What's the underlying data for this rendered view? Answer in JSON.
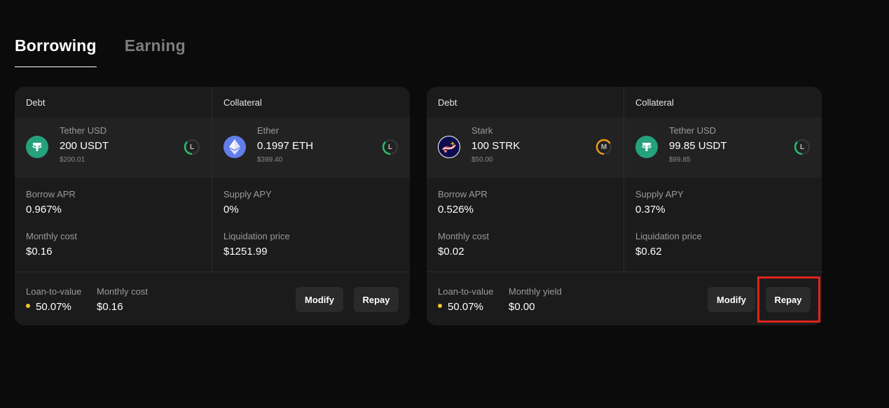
{
  "tabs": [
    {
      "label": "Borrowing",
      "active": true
    },
    {
      "label": "Earning",
      "active": false
    }
  ],
  "positions": [
    {
      "debt": {
        "section_label": "Debt",
        "token_name": "Tether USD",
        "amount": "200 USDT",
        "usd": "$200.01",
        "icon": "tether-icon",
        "risk_letter": "L",
        "risk_color": "#27c46b",
        "stat1_label": "Borrow APR",
        "stat1_value": "0.967%",
        "stat2_label": "Monthly cost",
        "stat2_value": "$0.16"
      },
      "collateral": {
        "section_label": "Collateral",
        "token_name": "Ether",
        "amount": "0.1997 ETH",
        "usd": "$399.40",
        "icon": "ether-icon",
        "risk_letter": "L",
        "risk_color": "#27c46b",
        "stat1_label": "Supply APY",
        "stat1_value": "0%",
        "stat2_label": "Liquidation price",
        "stat2_value": "$1251.99"
      },
      "footer": {
        "ltv_label": "Loan-to-value",
        "ltv_value": "50.07%",
        "monthly_label": "Monthly cost",
        "monthly_value": "$0.16",
        "modify_label": "Modify",
        "repay_label": "Repay"
      }
    },
    {
      "debt": {
        "section_label": "Debt",
        "token_name": "Stark",
        "amount": "100 STRK",
        "usd": "$50.00",
        "icon": "stark-icon",
        "risk_letter": "M",
        "risk_color": "#f39c12",
        "stat1_label": "Borrow APR",
        "stat1_value": "0.526%",
        "stat2_label": "Monthly cost",
        "stat2_value": "$0.02"
      },
      "collateral": {
        "section_label": "Collateral",
        "token_name": "Tether USD",
        "amount": "99.85 USDT",
        "usd": "$99.85",
        "icon": "tether-icon",
        "risk_letter": "L",
        "risk_color": "#27c46b",
        "stat1_label": "Supply APY",
        "stat1_value": "0.37%",
        "stat2_label": "Liquidation price",
        "stat2_value": "$0.62"
      },
      "footer": {
        "ltv_label": "Loan-to-value",
        "ltv_value": "50.07%",
        "monthly_label": "Monthly yield",
        "monthly_value": "$0.00",
        "modify_label": "Modify",
        "repay_label": "Repay"
      }
    }
  ],
  "colors": {
    "background": "#0c0b0b",
    "card": "#1b1b1b",
    "ltv_dot": "#f5c233",
    "highlight": "#e0231a",
    "tether": "#26a17b",
    "ether": "#627eea"
  }
}
